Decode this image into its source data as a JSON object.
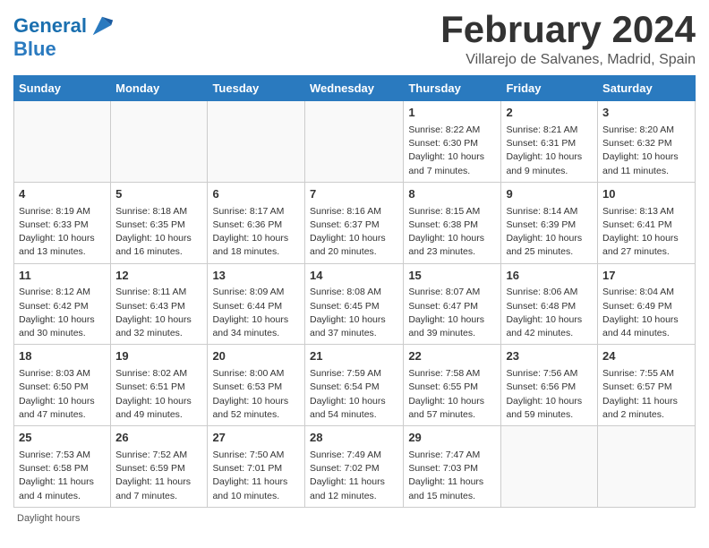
{
  "header": {
    "logo_line1": "General",
    "logo_line2": "Blue",
    "title": "February 2024",
    "subtitle": "Villarejo de Salvanes, Madrid, Spain"
  },
  "weekdays": [
    "Sunday",
    "Monday",
    "Tuesday",
    "Wednesday",
    "Thursday",
    "Friday",
    "Saturday"
  ],
  "weeks": [
    [
      {
        "day": "",
        "content": ""
      },
      {
        "day": "",
        "content": ""
      },
      {
        "day": "",
        "content": ""
      },
      {
        "day": "",
        "content": ""
      },
      {
        "day": "1",
        "content": "Sunrise: 8:22 AM\nSunset: 6:30 PM\nDaylight: 10 hours\nand 7 minutes."
      },
      {
        "day": "2",
        "content": "Sunrise: 8:21 AM\nSunset: 6:31 PM\nDaylight: 10 hours\nand 9 minutes."
      },
      {
        "day": "3",
        "content": "Sunrise: 8:20 AM\nSunset: 6:32 PM\nDaylight: 10 hours\nand 11 minutes."
      }
    ],
    [
      {
        "day": "4",
        "content": "Sunrise: 8:19 AM\nSunset: 6:33 PM\nDaylight: 10 hours\nand 13 minutes."
      },
      {
        "day": "5",
        "content": "Sunrise: 8:18 AM\nSunset: 6:35 PM\nDaylight: 10 hours\nand 16 minutes."
      },
      {
        "day": "6",
        "content": "Sunrise: 8:17 AM\nSunset: 6:36 PM\nDaylight: 10 hours\nand 18 minutes."
      },
      {
        "day": "7",
        "content": "Sunrise: 8:16 AM\nSunset: 6:37 PM\nDaylight: 10 hours\nand 20 minutes."
      },
      {
        "day": "8",
        "content": "Sunrise: 8:15 AM\nSunset: 6:38 PM\nDaylight: 10 hours\nand 23 minutes."
      },
      {
        "day": "9",
        "content": "Sunrise: 8:14 AM\nSunset: 6:39 PM\nDaylight: 10 hours\nand 25 minutes."
      },
      {
        "day": "10",
        "content": "Sunrise: 8:13 AM\nSunset: 6:41 PM\nDaylight: 10 hours\nand 27 minutes."
      }
    ],
    [
      {
        "day": "11",
        "content": "Sunrise: 8:12 AM\nSunset: 6:42 PM\nDaylight: 10 hours\nand 30 minutes."
      },
      {
        "day": "12",
        "content": "Sunrise: 8:11 AM\nSunset: 6:43 PM\nDaylight: 10 hours\nand 32 minutes."
      },
      {
        "day": "13",
        "content": "Sunrise: 8:09 AM\nSunset: 6:44 PM\nDaylight: 10 hours\nand 34 minutes."
      },
      {
        "day": "14",
        "content": "Sunrise: 8:08 AM\nSunset: 6:45 PM\nDaylight: 10 hours\nand 37 minutes."
      },
      {
        "day": "15",
        "content": "Sunrise: 8:07 AM\nSunset: 6:47 PM\nDaylight: 10 hours\nand 39 minutes."
      },
      {
        "day": "16",
        "content": "Sunrise: 8:06 AM\nSunset: 6:48 PM\nDaylight: 10 hours\nand 42 minutes."
      },
      {
        "day": "17",
        "content": "Sunrise: 8:04 AM\nSunset: 6:49 PM\nDaylight: 10 hours\nand 44 minutes."
      }
    ],
    [
      {
        "day": "18",
        "content": "Sunrise: 8:03 AM\nSunset: 6:50 PM\nDaylight: 10 hours\nand 47 minutes."
      },
      {
        "day": "19",
        "content": "Sunrise: 8:02 AM\nSunset: 6:51 PM\nDaylight: 10 hours\nand 49 minutes."
      },
      {
        "day": "20",
        "content": "Sunrise: 8:00 AM\nSunset: 6:53 PM\nDaylight: 10 hours\nand 52 minutes."
      },
      {
        "day": "21",
        "content": "Sunrise: 7:59 AM\nSunset: 6:54 PM\nDaylight: 10 hours\nand 54 minutes."
      },
      {
        "day": "22",
        "content": "Sunrise: 7:58 AM\nSunset: 6:55 PM\nDaylight: 10 hours\nand 57 minutes."
      },
      {
        "day": "23",
        "content": "Sunrise: 7:56 AM\nSunset: 6:56 PM\nDaylight: 10 hours\nand 59 minutes."
      },
      {
        "day": "24",
        "content": "Sunrise: 7:55 AM\nSunset: 6:57 PM\nDaylight: 11 hours\nand 2 minutes."
      }
    ],
    [
      {
        "day": "25",
        "content": "Sunrise: 7:53 AM\nSunset: 6:58 PM\nDaylight: 11 hours\nand 4 minutes."
      },
      {
        "day": "26",
        "content": "Sunrise: 7:52 AM\nSunset: 6:59 PM\nDaylight: 11 hours\nand 7 minutes."
      },
      {
        "day": "27",
        "content": "Sunrise: 7:50 AM\nSunset: 7:01 PM\nDaylight: 11 hours\nand 10 minutes."
      },
      {
        "day": "28",
        "content": "Sunrise: 7:49 AM\nSunset: 7:02 PM\nDaylight: 11 hours\nand 12 minutes."
      },
      {
        "day": "29",
        "content": "Sunrise: 7:47 AM\nSunset: 7:03 PM\nDaylight: 11 hours\nand 15 minutes."
      },
      {
        "day": "",
        "content": ""
      },
      {
        "day": "",
        "content": ""
      }
    ]
  ],
  "footer": {
    "daylight_label": "Daylight hours"
  }
}
